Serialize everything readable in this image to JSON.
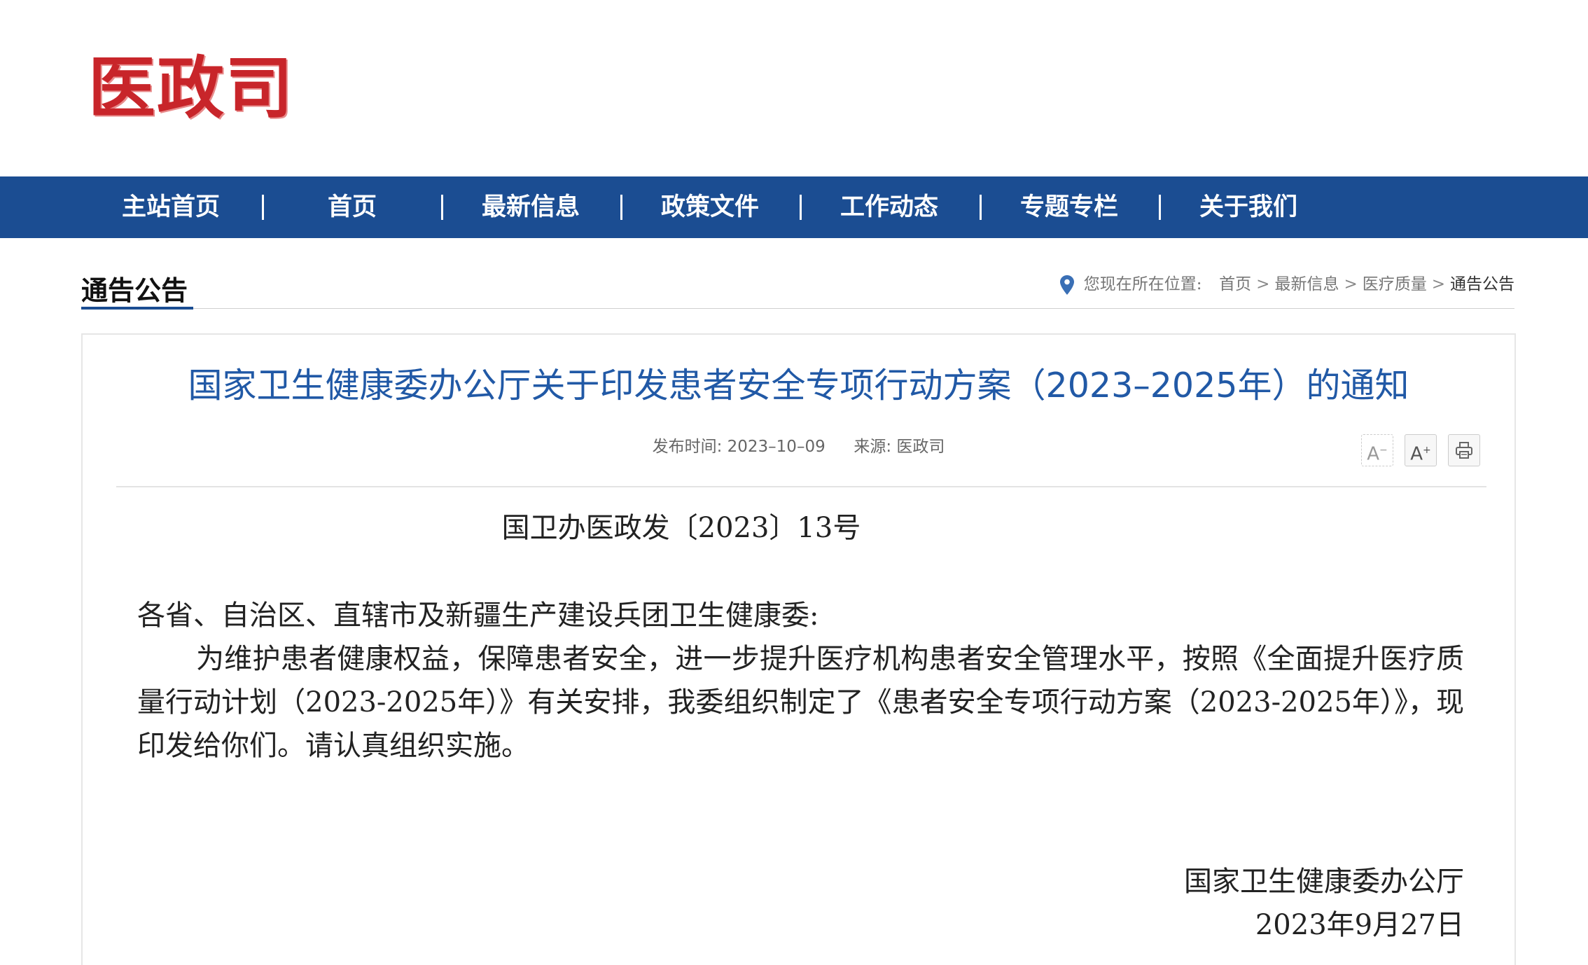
{
  "header": {
    "logo_text": "医政司"
  },
  "nav": {
    "items": [
      {
        "label": "主站首页"
      },
      {
        "label": "首页"
      },
      {
        "label": "最新信息"
      },
      {
        "label": "政策文件"
      },
      {
        "label": "工作动态"
      },
      {
        "label": "专题专栏"
      },
      {
        "label": "关于我们"
      }
    ]
  },
  "section": {
    "title": "通告公告"
  },
  "breadcrumb": {
    "prefix": "您现在所在位置:",
    "items": [
      "首页",
      "最新信息",
      "医疗质量",
      "通告公告"
    ],
    "separator": ">"
  },
  "article": {
    "title": "国家卫生健康委办公厅关于印发患者安全专项行动方案（2023–2025年）的通知",
    "publish_label": "发布时间:",
    "publish_date": "2023–10–09",
    "source_label": "来源:",
    "source": "医政司",
    "tools": {
      "smaller_label": "A",
      "larger_label": "A",
      "print_icon": "printer-icon"
    },
    "doc_number": "国卫办医政发〔2023〕13号",
    "salutation": "各省、自治区、直辖市及新疆生产建设兵团卫生健康委:",
    "paragraph": "为维护患者健康权益，保障患者安全，进一步提升医疗机构患者安全管理水平，按照《全面提升医疗质量行动计划（2023-2025年）》有关安排，我委组织制定了《患者安全专项行动方案（2023-2025年）》，现印发给你们。请认真组织实施。",
    "signature_org": "国家卫生健康委办公厅",
    "signature_date": "2023年9月27日"
  },
  "colors": {
    "nav_bg": "#1b4d92",
    "logo_red": "#c8252a",
    "title_blue": "#2159a6"
  }
}
